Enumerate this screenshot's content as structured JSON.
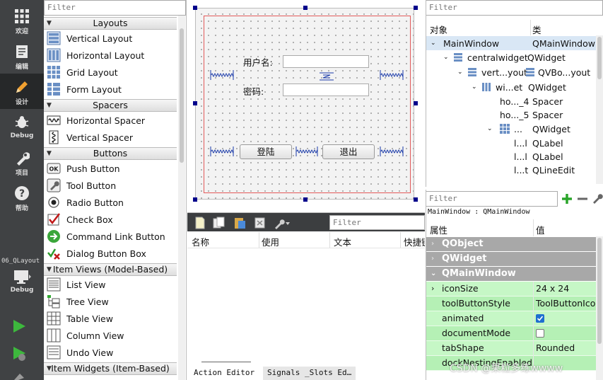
{
  "modes": [
    {
      "id": "welcome",
      "label": "欢迎",
      "icon": "grid-icon"
    },
    {
      "id": "edit",
      "label": "编辑",
      "icon": "document-icon"
    },
    {
      "id": "design",
      "label": "设计",
      "icon": "pencil-icon",
      "selected": true
    },
    {
      "id": "debug",
      "label": "Debug",
      "icon": "bug-icon"
    },
    {
      "id": "projects",
      "label": "项目",
      "icon": "wrench-icon"
    },
    {
      "id": "help",
      "label": "帮助",
      "icon": "question-icon"
    }
  ],
  "kit": {
    "project": "06_QLayout",
    "mode": "Debug"
  },
  "widget_box": {
    "filter_placeholder": "Filter",
    "categories": {
      "layouts": "Layouts",
      "spacers": "Spacers",
      "buttons": "Buttons",
      "item_views": "Item Views (Model-Based)",
      "item_widgets": "Item Widgets (Item-Based)"
    },
    "items": {
      "vertical_layout": "Vertical Layout",
      "horizontal_layout": "Horizontal Layout",
      "grid_layout": "Grid Layout",
      "form_layout": "Form Layout",
      "horizontal_spacer": "Horizontal Spacer",
      "vertical_spacer": "Vertical Spacer",
      "push_button": "Push Button",
      "tool_button": "Tool Button",
      "radio_button": "Radio Button",
      "check_box": "Check Box",
      "command_link_button": "Command Link Button",
      "dialog_button_box": "Dialog Button Box",
      "list_view": "List View",
      "tree_view": "Tree View",
      "table_view": "Table View",
      "column_view": "Column View",
      "undo_view": "Undo View"
    }
  },
  "form": {
    "username_label": "用户名:",
    "password_label": "密码:",
    "login_button": "登陆",
    "exit_button": "退出"
  },
  "object_inspector": {
    "filter_placeholder": "Filter",
    "col_object": "对象",
    "col_class": "类",
    "rows": [
      {
        "name": "MainWindow",
        "cls": "QMainWindow"
      },
      {
        "name": "centralwidget",
        "cls": "QWidget"
      },
      {
        "name": "vert...yout",
        "cls": "QVBo...yout"
      },
      {
        "name": "wi...et",
        "cls": "QWidget"
      },
      {
        "name": "ho..._4",
        "cls": "Spacer"
      },
      {
        "name": "ho..._5",
        "cls": "Spacer"
      },
      {
        "name": "...",
        "cls": "QWidget"
      },
      {
        "name": "l...l",
        "cls": "QLabel"
      },
      {
        "name": "l...l",
        "cls": "QLabel"
      },
      {
        "name": "l...t",
        "cls": "QLineEdit"
      }
    ]
  },
  "property_editor": {
    "filter_placeholder": "Filter",
    "context": "MainWindow : QMainWindow",
    "col_property": "属性",
    "col_value": "值",
    "groups": [
      "QObject",
      "QWidget",
      "QMainWindow"
    ],
    "rows": [
      {
        "name": "iconSize",
        "value": "24 x 24"
      },
      {
        "name": "toolButtonStyle",
        "value": "ToolButtonIco..."
      },
      {
        "name": "animated",
        "value": ""
      },
      {
        "name": "documentMode",
        "value": ""
      },
      {
        "name": "tabShape",
        "value": "Rounded"
      },
      {
        "name": "dockNestingEnabled",
        "value": ""
      }
    ],
    "animated_checked": true,
    "document_mode_checked": false
  },
  "action_editor": {
    "filter_placeholder": "Filter",
    "columns": [
      "名称",
      "使用",
      "文本",
      "快捷键"
    ],
    "tabs": [
      "Action Editor",
      "Signals _Slots Ed…"
    ]
  },
  "watermark": "CSDN @果粒多练wwww",
  "colors": {
    "modebar": "#404244",
    "layout_border": "#e25a5a",
    "handle": "#00008b",
    "prop_green": "#c6f7c6",
    "prop_group": "#a8a8a8"
  }
}
